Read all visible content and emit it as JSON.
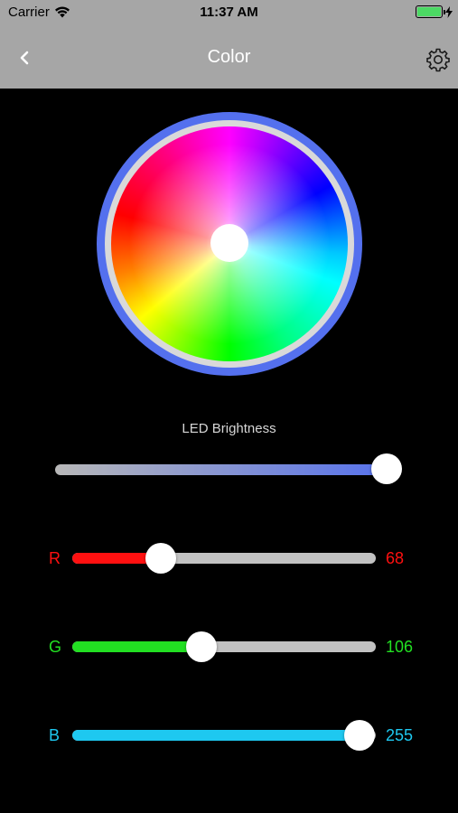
{
  "status_bar": {
    "carrier": "Carrier",
    "time": "11:37 AM",
    "battery_level": 1.0
  },
  "nav": {
    "title": "Color",
    "back_icon": "chevron-left-icon",
    "settings_icon": "gear-icon"
  },
  "colors": {
    "ring": "#5470ee",
    "red": "#ff1010",
    "green": "#22e022",
    "blue": "#1ec8f0"
  },
  "brightness": {
    "label": "LED Brightness",
    "level": 1.0
  },
  "channels": {
    "r": {
      "label": "R",
      "value": "68",
      "level": 68
    },
    "g": {
      "label": "G",
      "value": "106",
      "level": 106
    },
    "b": {
      "label": "B",
      "value": "255",
      "level": 255
    }
  }
}
